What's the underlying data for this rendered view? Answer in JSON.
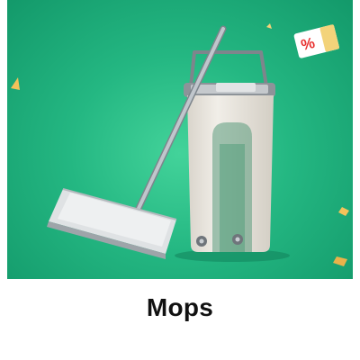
{
  "tile": {
    "label": "Mops",
    "badge_symbol": "%"
  },
  "colors": {
    "background_top": "#43d39a",
    "background_edge": "#13996a",
    "bucket": "#ebe7df",
    "handle": "#c9ced3",
    "badge": "#e8312f",
    "confetti": "#f3c25a"
  },
  "icons": {
    "product": "mop-and-bucket-image",
    "badge": "percent-tag-icon"
  }
}
